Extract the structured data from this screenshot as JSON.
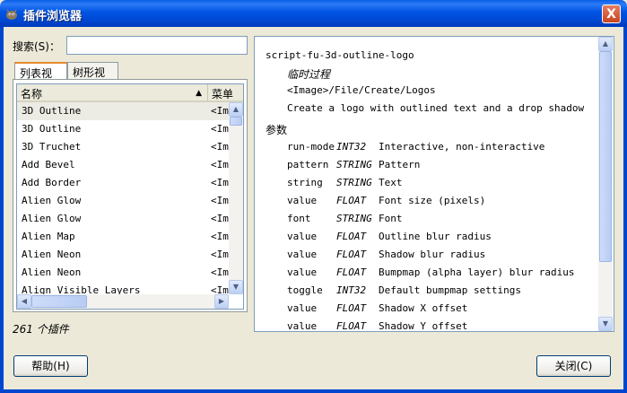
{
  "window": {
    "title": "插件浏览器",
    "close_glyph": "X"
  },
  "search": {
    "label": "搜索(S)：",
    "value": ""
  },
  "tabs": [
    {
      "label": "列表视图",
      "active": true
    },
    {
      "label": "树形视图",
      "active": false
    }
  ],
  "list": {
    "columns": [
      "名称",
      "菜单"
    ],
    "columns_visible": [
      "名称",
      "菜单"
    ],
    "sort_indicator": "▲",
    "rows": [
      {
        "name": "3D Outline",
        "menu": "<Image>/File/Create/Logos"
      },
      {
        "name": "3D Outline",
        "menu": "<Image>/Filters/Alpha to Logo"
      },
      {
        "name": "3D Truchet",
        "menu": "<Image>/File/Create/Patterns"
      },
      {
        "name": "Add Bevel",
        "menu": "<Image>/Filters/Decor"
      },
      {
        "name": "Add Border",
        "menu": "<Image>/Filters/Decor"
      },
      {
        "name": "Alien Glow",
        "menu": "<Image>/File/Create/Logos"
      },
      {
        "name": "Alien Glow",
        "menu": "<Image>/Filters/Alpha to Logo"
      },
      {
        "name": "Alien Map",
        "menu": "<Image>/Filters/Colors/Map"
      },
      {
        "name": "Alien Neon",
        "menu": "<Image>/File/Create/Logos"
      },
      {
        "name": "Alien Neon",
        "menu": "<Image>/Filters/Alpha to Logo"
      },
      {
        "name": "Align Visible Layers",
        "menu": "<Image>/Image"
      }
    ],
    "row_menu_visible": "<Im",
    "selected_index": 0,
    "scroll_fraction": 0.0
  },
  "plugin_count": "261 个插件",
  "details": {
    "proc_name": "script-fu-3d-outline-logo",
    "proc_type": "临时过程",
    "menu_path": "<Image>/File/Create/Logos",
    "blurb": "Create a logo with outlined text and a drop shadow",
    "params_heading": "参数",
    "params": [
      {
        "name": "run-mode",
        "type": "INT32",
        "desc": "Interactive, non-interactive"
      },
      {
        "name": "pattern",
        "type": "STRING",
        "desc": "Pattern"
      },
      {
        "name": "string",
        "type": "STRING",
        "desc": "Text"
      },
      {
        "name": "value",
        "type": "FLOAT",
        "desc": "Font size (pixels)"
      },
      {
        "name": "font",
        "type": "STRING",
        "desc": "Font"
      },
      {
        "name": "value",
        "type": "FLOAT",
        "desc": "Outline blur radius"
      },
      {
        "name": "value",
        "type": "FLOAT",
        "desc": "Shadow blur radius"
      },
      {
        "name": "value",
        "type": "FLOAT",
        "desc": "Bumpmap (alpha layer) blur radius"
      },
      {
        "name": "toggle",
        "type": "INT32",
        "desc": "Default bumpmap settings"
      },
      {
        "name": "value",
        "type": "FLOAT",
        "desc": "Shadow X offset"
      },
      {
        "name": "value",
        "type": "FLOAT",
        "desc": "Shadow Y offset"
      }
    ],
    "scroll_fraction": 0.0
  },
  "buttons": {
    "help_label": "帮助(H)",
    "close_label": "关闭(C)"
  },
  "colors": {
    "title_bar": "#0054e3",
    "dialog_bg": "#ece9d8",
    "close_button": "#d4502a"
  }
}
